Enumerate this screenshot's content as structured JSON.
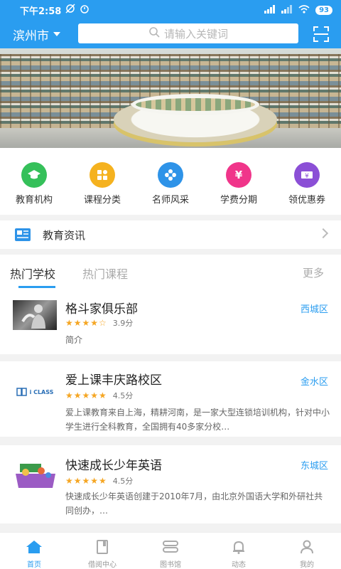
{
  "status_bar": {
    "time": "下午2:58",
    "battery": "93"
  },
  "header": {
    "city": "滨州市",
    "search_placeholder": "请输入关键词",
    "scan_icon": "scan-icon"
  },
  "quick_links": [
    {
      "label": "教育机构",
      "color": "#35c05a",
      "icon": "graduation-cap-icon"
    },
    {
      "label": "课程分类",
      "color": "#f5b21f",
      "icon": "grid-icon"
    },
    {
      "label": "名师风采",
      "color": "#2e93e8",
      "icon": "flower-icon"
    },
    {
      "label": "学费分期",
      "color": "#f0358a",
      "icon": "yen-icon"
    },
    {
      "label": "领优惠券",
      "color": "#8b4fd6",
      "icon": "coupon-icon"
    }
  ],
  "news": {
    "title": "教育资讯"
  },
  "tabs": {
    "hot_schools": "热门学校",
    "hot_courses": "热门课程",
    "more": "更多"
  },
  "schools": [
    {
      "name": "格斗家俱乐部",
      "district": "西城区",
      "stars": "★★★★☆",
      "rating": 3.9,
      "score": "3.9分",
      "desc": "简介"
    },
    {
      "name": "爱上课丰庆路校区",
      "district": "金水区",
      "stars": "★★★★★",
      "rating": 4.5,
      "score": "4.5分",
      "desc": "爱上课教育来自上海，精耕河南，是一家大型连锁培训机构，针对中小学生进行全科教育，全国拥有40多家分校…",
      "logo_text": "i CLASS"
    },
    {
      "name": "快速成长少年英语",
      "district": "东城区",
      "stars": "★★★★★",
      "rating": 4.5,
      "score": "4.5分",
      "desc": "快速成长少年英语创建于2010年7月，由北京外国语大学和外研社共同创办，…"
    }
  ],
  "tabbar": [
    {
      "label": "首页",
      "active": true
    },
    {
      "label": "借阅中心",
      "active": false
    },
    {
      "label": "图书馆",
      "active": false
    },
    {
      "label": "动态",
      "active": false
    },
    {
      "label": "我的",
      "active": false
    }
  ],
  "colors": {
    "primary": "#2a9df0",
    "star": "#f5a623"
  }
}
